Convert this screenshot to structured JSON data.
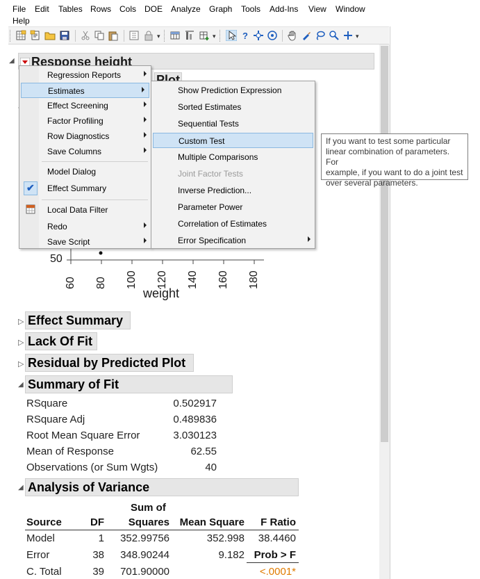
{
  "menu": {
    "items": [
      "File",
      "Edit",
      "Tables",
      "Rows",
      "Cols",
      "DOE",
      "Analyze",
      "Graph",
      "Tools",
      "Add-Ins",
      "View",
      "Window",
      "Help"
    ]
  },
  "report": {
    "title": "Response height",
    "hidden_title_fragment": "Plot",
    "plot": {
      "x_axis_label": "weight",
      "x_ticks": [
        "60",
        "80",
        "100",
        "120",
        "140",
        "160",
        "180"
      ],
      "y_tick": "50"
    },
    "sections": {
      "effect_summary": "Effect Summary",
      "lack_of_fit": "Lack Of Fit",
      "residual_plot": "Residual by Predicted Plot",
      "summary_of_fit": "Summary of Fit",
      "anova": "Analysis of Variance"
    },
    "summary_of_fit": [
      {
        "label": "RSquare",
        "value": "0.502917"
      },
      {
        "label": "RSquare Adj",
        "value": "0.489836"
      },
      {
        "label": "Root Mean Square Error",
        "value": "3.030123"
      },
      {
        "label": "Mean of Response",
        "value": "62.55"
      },
      {
        "label": "Observations (or Sum Wgts)",
        "value": "40"
      }
    ],
    "anova": {
      "header_top": "Sum of",
      "headers": [
        "Source",
        "DF",
        "Squares",
        "Mean Square",
        "F Ratio"
      ],
      "rows": [
        {
          "source": "Model",
          "df": "1",
          "ss": "352.99756",
          "ms": "352.998",
          "f": "38.4460"
        },
        {
          "source": "Error",
          "df": "38",
          "ss": "348.90244",
          "ms": "9.182",
          "f": "Prob > F"
        },
        {
          "source": "C. Total",
          "df": "39",
          "ss": "701.90000",
          "ms": "",
          "f": "<.0001*"
        }
      ],
      "prob_color": "#e07b00"
    }
  },
  "popup_menu": {
    "items": [
      {
        "label": "Regression Reports",
        "submenu": true
      },
      {
        "label": "Estimates",
        "submenu": true,
        "highlight": true
      },
      {
        "label": "Effect Screening",
        "submenu": true
      },
      {
        "label": "Factor Profiling",
        "submenu": true
      },
      {
        "label": "Row Diagnostics",
        "submenu": true
      },
      {
        "label": "Save Columns",
        "submenu": true
      },
      {
        "label": "Model Dialog",
        "submenu": false
      },
      {
        "label": "Effect Summary",
        "submenu": false,
        "checked": true
      },
      {
        "label": "Local Data Filter",
        "submenu": false,
        "icon": "filter-icon"
      },
      {
        "label": "Redo",
        "submenu": true
      },
      {
        "label": "Save Script",
        "submenu": true
      }
    ]
  },
  "estimates_submenu": {
    "items": [
      {
        "label": "Show Prediction Expression"
      },
      {
        "label": "Sorted Estimates"
      },
      {
        "label": "Sequential Tests"
      },
      {
        "label": "Custom Test",
        "highlight": true
      },
      {
        "label": "Multiple Comparisons"
      },
      {
        "label": "Joint Factor Tests",
        "disabled": true
      },
      {
        "label": "Inverse Prediction..."
      },
      {
        "label": "Parameter Power"
      },
      {
        "label": "Correlation of Estimates"
      },
      {
        "label": "Error Specification",
        "submenu": true
      }
    ]
  },
  "tooltip": {
    "lines": [
      "If you want to test some particular",
      "linear combination of parameters. For",
      "example, if you want to do a joint test",
      "over several parameters."
    ]
  },
  "colors": {
    "highlight": "#cfe3f5",
    "red_triangle": "#cc0000",
    "accent_blue": "#1f6fc5"
  }
}
